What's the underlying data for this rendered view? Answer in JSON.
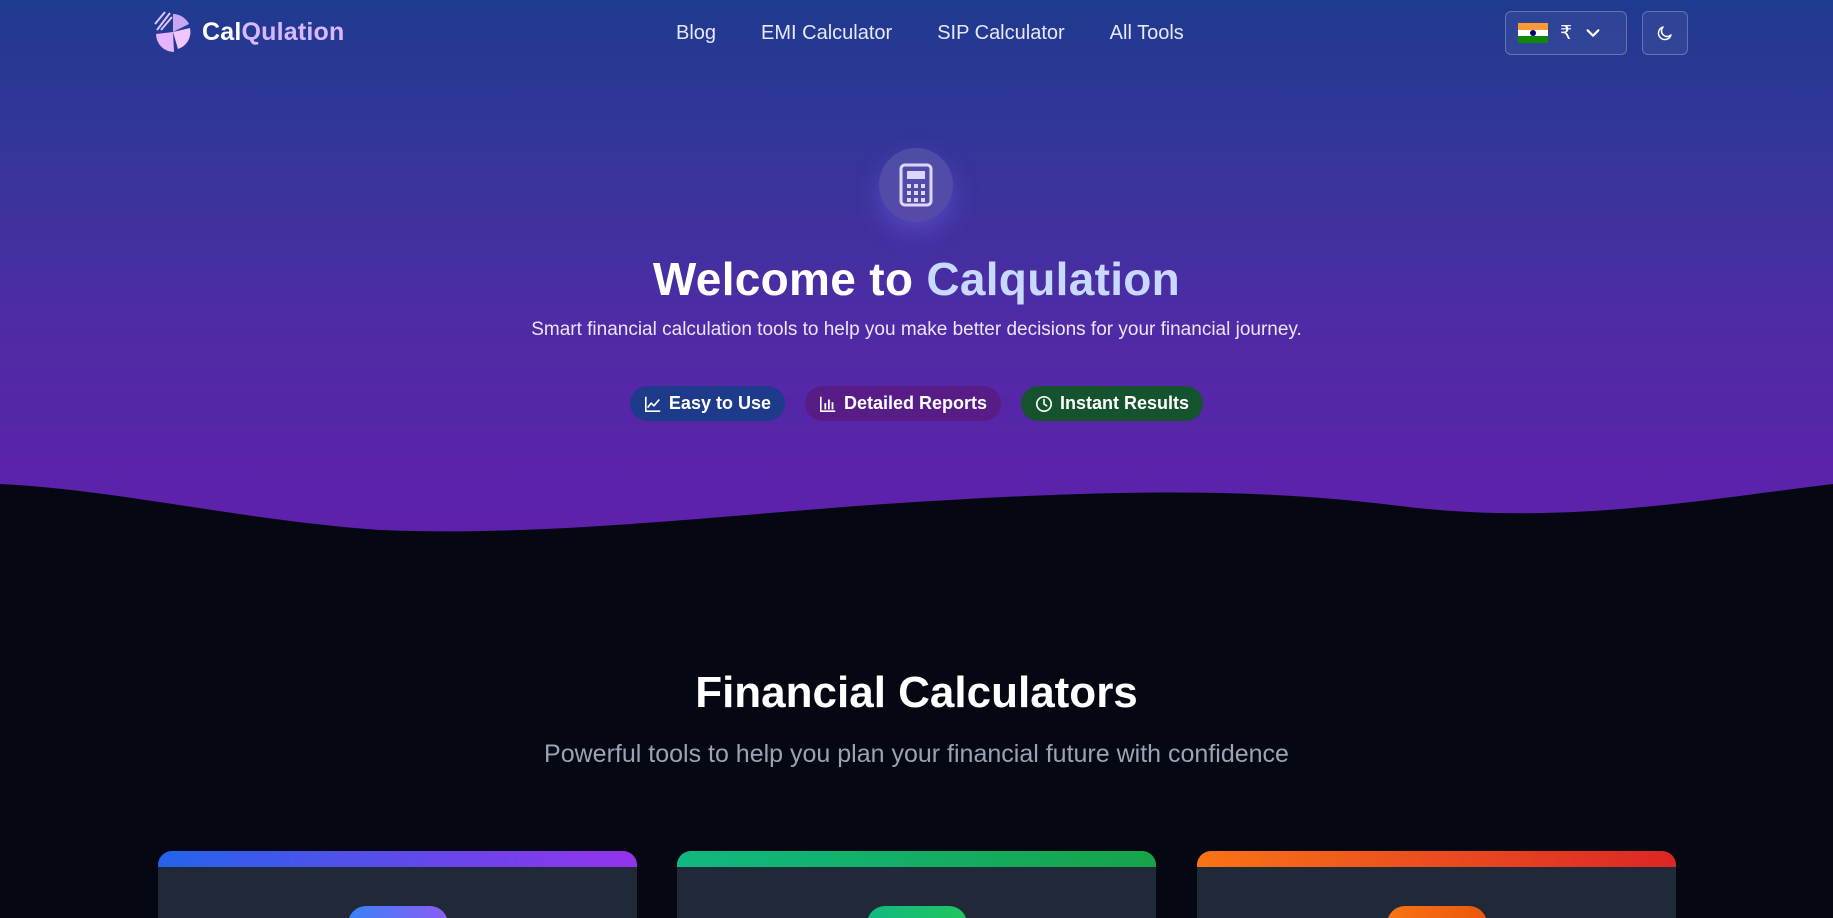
{
  "brand": {
    "name_part1": "Cal",
    "name_part2": "Qulation",
    "logo_icon": "pie-chart-logo-icon"
  },
  "nav": {
    "links": [
      {
        "label": "Blog"
      },
      {
        "label": "EMI Calculator"
      },
      {
        "label": "SIP Calculator"
      },
      {
        "label": "All Tools"
      }
    ],
    "currency": {
      "flag": "india-flag-icon",
      "symbol": "₹",
      "dropdown_icon": "chevron-down-icon"
    },
    "theme_toggle_icon": "moon-icon"
  },
  "hero": {
    "icon": "calculator-icon",
    "title_part1": "Welcome to ",
    "title_part2": "Calqulation",
    "subtitle": "Smart financial calculation tools to help you make better decisions for your financial journey.",
    "badges": [
      {
        "label": "Easy to Use",
        "icon": "line-chart-icon",
        "color": "#1e3a8a"
      },
      {
        "label": "Detailed Reports",
        "icon": "bar-chart-icon",
        "color": "#581c87"
      },
      {
        "label": "Instant Results",
        "icon": "clock-icon",
        "color": "#14532d"
      }
    ]
  },
  "section": {
    "title": "Financial Calculators",
    "subtitle": "Powerful tools to help you plan your financial future with confidence"
  },
  "cards": [
    {
      "gradient_from": "#2563eb",
      "gradient_to": "#9333ea"
    },
    {
      "gradient_from": "#10b981",
      "gradient_to": "#16a34a"
    },
    {
      "gradient_from": "#f97316",
      "gradient_to": "#dc2626"
    }
  ],
  "colors": {
    "hero_top": "#1f3a8f",
    "hero_bottom": "#5f20ad",
    "page_bg": "#050812",
    "card_bg": "#1f2937"
  }
}
